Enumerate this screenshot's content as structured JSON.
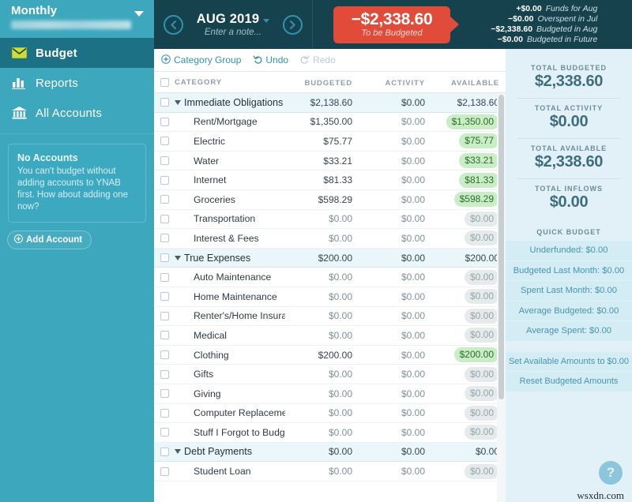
{
  "sidebar": {
    "budget_picker": {
      "title": "Monthly",
      "subtitle_redacted": ""
    },
    "nav": [
      {
        "label": "Budget",
        "icon": "envelope-icon",
        "active": true
      },
      {
        "label": "Reports",
        "icon": "bar-chart-icon",
        "active": false
      },
      {
        "label": "All Accounts",
        "icon": "bank-icon",
        "active": false
      }
    ],
    "no_accounts": {
      "title": "No Accounts",
      "body": "You can't budget without adding accounts to YNAB first. How about adding one now?",
      "add_button": "Add Account"
    }
  },
  "header": {
    "prev_icon": "chevron-left-icon",
    "next_icon": "chevron-right-icon",
    "month": "AUG 2019",
    "note_placeholder": "Enter a note...",
    "to_be_budgeted": {
      "amount": "−$2,338.60",
      "label": "To be Budgeted"
    },
    "breakdown": [
      {
        "amount": "+$0.00",
        "label": "Funds for Aug"
      },
      {
        "amount": "−$0.00",
        "label": "Overspent in Jul"
      },
      {
        "amount": "−$2,338.60",
        "label": "Budgeted in Aug"
      },
      {
        "amount": "−$0.00",
        "label": "Budgeted in Future"
      }
    ]
  },
  "toolbar": {
    "category_group": "Category Group",
    "undo": "Undo",
    "redo": "Redo"
  },
  "table": {
    "columns": [
      "CATEGORY",
      "BUDGETED",
      "ACTIVITY",
      "AVAILABLE"
    ],
    "rows": [
      {
        "type": "group",
        "name": "Immediate Obligations",
        "budgeted": "$2,138.60",
        "activity": "$0.00",
        "available": "$2,138.60",
        "avail_style": "plain"
      },
      {
        "type": "item",
        "name": "Rent/Mortgage",
        "budgeted": "$1,350.00",
        "activity": "$0.00",
        "available": "$1,350.00",
        "avail_style": "green"
      },
      {
        "type": "item",
        "name": "Electric",
        "budgeted": "$75.77",
        "activity": "$0.00",
        "available": "$75.77",
        "avail_style": "green"
      },
      {
        "type": "item",
        "name": "Water",
        "budgeted": "$33.21",
        "activity": "$0.00",
        "available": "$33.21",
        "avail_style": "green"
      },
      {
        "type": "item",
        "name": "Internet",
        "budgeted": "$81.33",
        "activity": "$0.00",
        "available": "$81.33",
        "avail_style": "green"
      },
      {
        "type": "item",
        "name": "Groceries",
        "budgeted": "$598.29",
        "activity": "$0.00",
        "available": "$598.29",
        "avail_style": "green"
      },
      {
        "type": "item",
        "name": "Transportation",
        "budgeted": "$0.00",
        "activity": "$0.00",
        "available": "$0.00",
        "avail_style": "zero"
      },
      {
        "type": "item",
        "name": "Interest & Fees",
        "budgeted": "$0.00",
        "activity": "$0.00",
        "available": "$0.00",
        "avail_style": "zero"
      },
      {
        "type": "group",
        "name": "True Expenses",
        "budgeted": "$200.00",
        "activity": "$0.00",
        "available": "$200.00",
        "avail_style": "plain"
      },
      {
        "type": "item",
        "name": "Auto Maintenance",
        "budgeted": "$0.00",
        "activity": "$0.00",
        "available": "$0.00",
        "avail_style": "zero"
      },
      {
        "type": "item",
        "name": "Home Maintenance",
        "budgeted": "$0.00",
        "activity": "$0.00",
        "available": "$0.00",
        "avail_style": "zero"
      },
      {
        "type": "item",
        "name": "Renter's/Home Insurance",
        "budgeted": "$0.00",
        "activity": "$0.00",
        "available": "$0.00",
        "avail_style": "zero"
      },
      {
        "type": "item",
        "name": "Medical",
        "budgeted": "$0.00",
        "activity": "$0.00",
        "available": "$0.00",
        "avail_style": "zero"
      },
      {
        "type": "item",
        "name": "Clothing",
        "budgeted": "$200.00",
        "activity": "$0.00",
        "available": "$200.00",
        "avail_style": "green"
      },
      {
        "type": "item",
        "name": "Gifts",
        "budgeted": "$0.00",
        "activity": "$0.00",
        "available": "$0.00",
        "avail_style": "zero"
      },
      {
        "type": "item",
        "name": "Giving",
        "budgeted": "$0.00",
        "activity": "$0.00",
        "available": "$0.00",
        "avail_style": "zero"
      },
      {
        "type": "item",
        "name": "Computer Replacement",
        "budgeted": "$0.00",
        "activity": "$0.00",
        "available": "$0.00",
        "avail_style": "zero"
      },
      {
        "type": "item",
        "name": "Stuff I Forgot to Budget For",
        "budgeted": "$0.00",
        "activity": "$0.00",
        "available": "$0.00",
        "avail_style": "zero"
      },
      {
        "type": "group",
        "name": "Debt Payments",
        "budgeted": "$0.00",
        "activity": "$0.00",
        "available": "$0.00",
        "avail_style": "plain"
      },
      {
        "type": "item",
        "name": "Student Loan",
        "budgeted": "$0.00",
        "activity": "$0.00",
        "available": "$0.00",
        "avail_style": "zero"
      }
    ]
  },
  "inspector": {
    "totals": [
      {
        "label": "TOTAL BUDGETED",
        "value": "$2,338.60"
      },
      {
        "label": "TOTAL ACTIVITY",
        "value": "$0.00"
      },
      {
        "label": "TOTAL AVAILABLE",
        "value": "$2,338.60"
      },
      {
        "label": "TOTAL INFLOWS",
        "value": "$0.00"
      }
    ],
    "quick_budget": {
      "title": "QUICK BUDGET",
      "buttons": [
        "Underfunded: $0.00",
        "Budgeted Last Month: $0.00",
        "Spent Last Month: $0.00",
        "Average Budgeted: $0.00",
        "Average Spent: $0.00"
      ],
      "actions": [
        "Set Available Amounts to $0.00",
        "Reset Budgeted Amounts"
      ]
    }
  },
  "overlay": {
    "help_glyph": "?",
    "watermark": "wsxdn.com"
  }
}
